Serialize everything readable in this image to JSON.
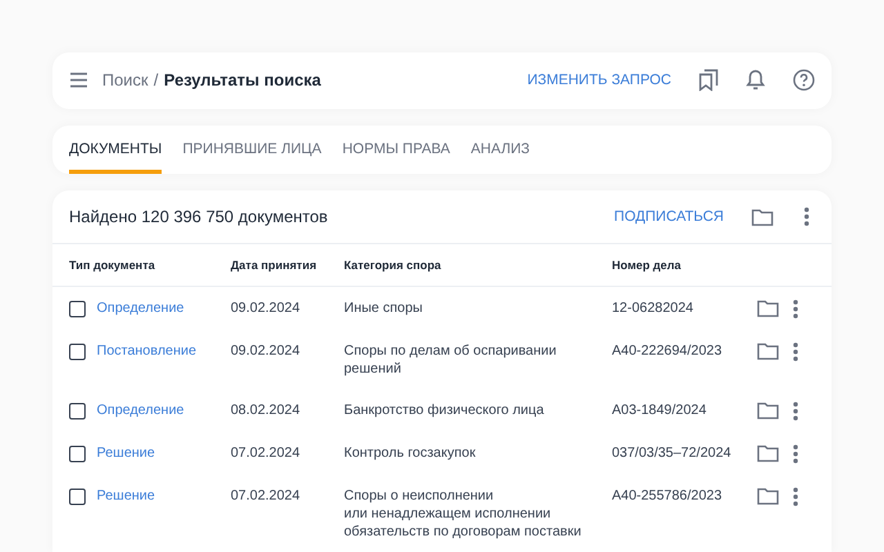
{
  "breadcrumb": {
    "parent": "Поиск",
    "separator": "/",
    "current": "Результаты поиска"
  },
  "header_action": "ИЗМЕНИТЬ ЗАПРОС",
  "tabs": [
    {
      "label": "ДОКУМЕНТЫ",
      "selected": true
    },
    {
      "label": "ПРИНЯВШИЕ ЛИЦА",
      "selected": false
    },
    {
      "label": "НОРМЫ ПРАВА",
      "selected": false
    },
    {
      "label": "АНАЛИЗ",
      "selected": false
    }
  ],
  "results": {
    "summary": "Найдено 120 396 750 документов",
    "action": "ПОДПИСАТЬСЯ"
  },
  "table": {
    "columns": [
      "Тип документа",
      "Дата принятия",
      "Категория спора",
      "Номер дела"
    ],
    "rows": [
      {
        "checked": false,
        "type": "Определение",
        "date": "09.02.2024",
        "category": "Иные споры",
        "number": "12-06282024"
      },
      {
        "checked": false,
        "type": "Постановление",
        "date": "09.02.2024",
        "category": "Споры по делам об оспаривании решений",
        "number": "А40-222694/2023"
      },
      {
        "checked": false,
        "type": "Определение",
        "date": "08.02.2024",
        "category": "Банкротство физического лица",
        "number": "А03-1849/2024"
      },
      {
        "checked": false,
        "type": "Решение",
        "date": "07.02.2024",
        "category": "Контроль госзакупок",
        "number": "037/03/35–72/2024"
      },
      {
        "checked": false,
        "type": "Решение",
        "date": "07.02.2024",
        "category": "Споры о неисполнении\nили ненадлежащем исполнении\nобязательств по договорам поставки",
        "number": "А40-255786/2023"
      }
    ]
  }
}
